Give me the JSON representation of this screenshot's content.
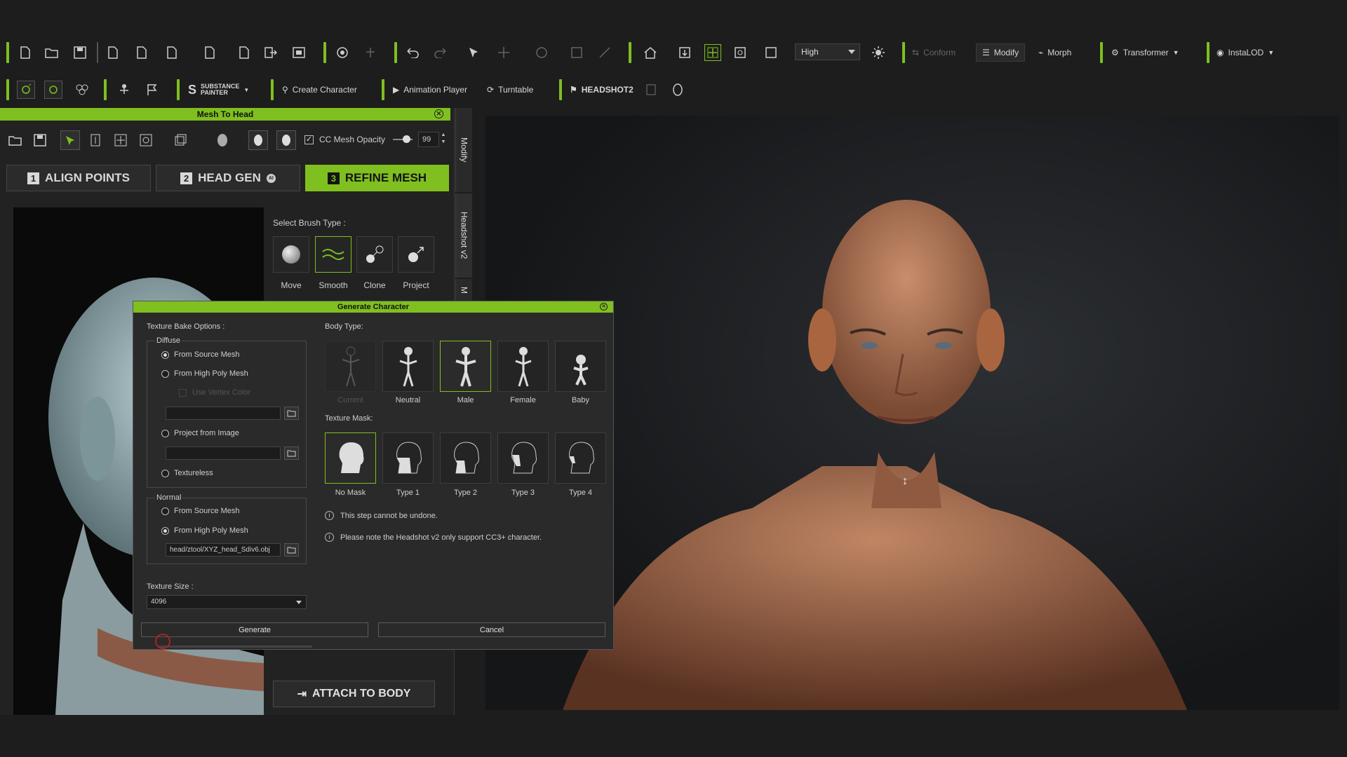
{
  "toolbar_row1": {
    "quality_select": "High",
    "conform": "Conform",
    "modify": "Modify",
    "morph": "Morph",
    "transformer": "Transformer",
    "instalod": "InstaLOD"
  },
  "toolbar_row2": {
    "substance": "SUBSTANCE\nPAINTER",
    "create_character": "Create Character",
    "animation_player": "Animation Player",
    "turntable": "Turntable",
    "headshot2": "HEADSHOT2"
  },
  "panel": {
    "title": "Mesh To Head",
    "cc_mesh_opacity_label": "CC Mesh Opacity",
    "cc_mesh_opacity_value": "99",
    "steps": [
      {
        "num": "1",
        "label": "ALIGN POINTS"
      },
      {
        "num": "2",
        "label": "HEAD GEN"
      },
      {
        "num": "3",
        "label": "REFINE MESH"
      }
    ],
    "select_brush_label": "Select Brush Type :",
    "brushes": [
      "Move",
      "Smooth",
      "Clone",
      "Project"
    ],
    "attach_to_body": "ATTACH TO BODY",
    "side_tabs": [
      "Modify",
      "Headshot v2",
      "M"
    ]
  },
  "dialog": {
    "title": "Generate Character",
    "texture_bake_options": "Texture Bake Options :",
    "diffuse_label": "Diffuse",
    "diffuse_options": [
      "From Source Mesh",
      "From High Poly Mesh",
      "Project from Image",
      "Textureless"
    ],
    "use_vertex_color": "Use Vertex Color",
    "normal_label": "Normal",
    "normal_options": [
      "From Source Mesh",
      "From High Poly Mesh"
    ],
    "normal_path": "head/ztool/XYZ_head_Sdiv6.obj",
    "texture_size_label": "Texture Size :",
    "texture_size_value": "4096",
    "body_type_label": "Body Type:",
    "body_types": [
      "Current",
      "Neutral",
      "Male",
      "Female",
      "Baby"
    ],
    "texture_mask_label": "Texture Mask:",
    "texture_masks": [
      "No Mask",
      "Type 1",
      "Type 2",
      "Type 3",
      "Type 4"
    ],
    "note1": "This step cannot be undone.",
    "note2": "Please note the Headshot v2 only support CC3+ character.",
    "generate": "Generate",
    "cancel": "Cancel"
  },
  "colors": {
    "accent": "#7fbf1f",
    "bg": "#1d1d1d"
  }
}
